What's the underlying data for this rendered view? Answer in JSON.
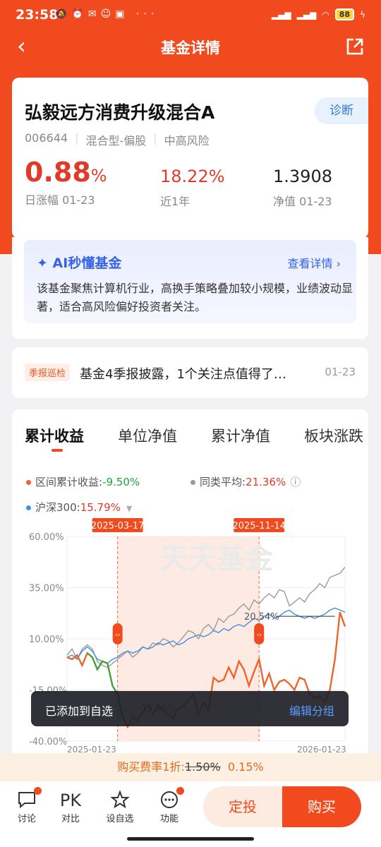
{
  "status": {
    "time": "23:58",
    "battery": "88",
    "net": "HD"
  },
  "nav": {
    "title": "基金详情"
  },
  "fund": {
    "name": "弘毅远方消费升级混合A",
    "code": "006644",
    "type": "混合型-偏股",
    "risk": "中高风险",
    "diagnose": "诊断",
    "daily_value": "0.88",
    "daily_unit": "%",
    "daily_label": "日涨幅 01-23",
    "year_value": "18.22%",
    "year_label": "近1年",
    "nav_value": "1.3908",
    "nav_label": "净值 01-23"
  },
  "ai": {
    "title": "AI秒懂基金",
    "more": "查看详情 ›",
    "text": "该基金聚焦计算机行业，高换手策略叠加较小规模，业绩波动显著，适合高风险偏好投资者关注。"
  },
  "report": {
    "tag": "季报巡检",
    "text": "基金4季报披露，1个关注点值得了…",
    "date": "01-23"
  },
  "chart_tabs": [
    "累计收益",
    "单位净值",
    "累计净值",
    "板块涨跌"
  ],
  "legend": {
    "interval_label": "区间累计收益:",
    "interval_value": "-9.50%",
    "peer_label": "同类平均:",
    "peer_value": "21.36%",
    "index_label": "沪深300:",
    "index_value": "15.79%"
  },
  "colors": {
    "brand": "#f04a1e",
    "fund_line": "#f0642c",
    "peer_line": "#9a9a9a",
    "index_line": "#3f8ee6",
    "drop_line": "#3aa83a"
  },
  "chart_data": {
    "type": "line",
    "x_range": [
      "2025-01-23",
      "2026-01-23"
    ],
    "ylim": [
      -40,
      60
    ],
    "yticks": [
      "60.00%",
      "35.00%",
      "10.00%",
      "-15.00%",
      "-40.00%"
    ],
    "xticks": [
      "2025-01-23",
      "2026-01-23"
    ],
    "selection": {
      "start": "2025-03-17",
      "end": "2025-11-14",
      "start_value": "-23.06%",
      "end_value": "20.54%"
    },
    "watermark": "天天基金",
    "series": [
      {
        "name": "区间累计收益",
        "values": [
          1,
          0,
          2,
          -3,
          3,
          1,
          -5,
          -1,
          -2,
          -13,
          -17,
          -28,
          -33,
          -28,
          -30,
          -26,
          -22,
          -27,
          -23,
          -25,
          -27,
          -29,
          -24,
          -23,
          -20,
          -17,
          -27,
          -21,
          -25,
          -9,
          -11,
          -10,
          -4,
          -9,
          -1,
          -5,
          -13,
          -6,
          0,
          -13,
          -7,
          -15,
          -11,
          -10,
          -12,
          -15,
          -9,
          -10,
          -17,
          -19,
          -18,
          -21,
          -15,
          0,
          23,
          16
        ]
      },
      {
        "name": "同类平均",
        "values": [
          2,
          5,
          0,
          5,
          7,
          5,
          -1,
          -3,
          -4,
          -2,
          0,
          2,
          4,
          1,
          3,
          6,
          5,
          8,
          7,
          10,
          9,
          6,
          8,
          11,
          14,
          13,
          10,
          15,
          17,
          14,
          20,
          18,
          21,
          22,
          25,
          27,
          24,
          29,
          27,
          30,
          32,
          30,
          34,
          33,
          26,
          28,
          30,
          28,
          32,
          34,
          37,
          35,
          40,
          41,
          42,
          45
        ]
      },
      {
        "name": "沪深300",
        "values": [
          1,
          2,
          0,
          4,
          6,
          4,
          0,
          -1,
          -2,
          0,
          1,
          3,
          4,
          3,
          4,
          6,
          5,
          6,
          8,
          7,
          8,
          9,
          7,
          8,
          10,
          11,
          12,
          11,
          12,
          14,
          13,
          15,
          14,
          16,
          17,
          16,
          18,
          20,
          19,
          21,
          22,
          20,
          21,
          23,
          24,
          22,
          21,
          20,
          21,
          20,
          21,
          22,
          24,
          25,
          24,
          23
        ]
      }
    ]
  },
  "toast": {
    "message": "已添加到自选",
    "action": "编辑分组"
  },
  "promo": {
    "prefix": "购买费率1折:",
    "old_rate": "1.50%",
    "new_rate": "0.15%"
  },
  "bottom": {
    "items": [
      {
        "icon": "chat-icon",
        "label": "讨论"
      },
      {
        "icon": "pk-icon",
        "label": "对比",
        "glyph": "PK"
      },
      {
        "icon": "star-icon",
        "label": "设自选"
      },
      {
        "icon": "more-icon",
        "label": "功能"
      }
    ],
    "plan_label": "定投",
    "buy_label": "购买"
  }
}
